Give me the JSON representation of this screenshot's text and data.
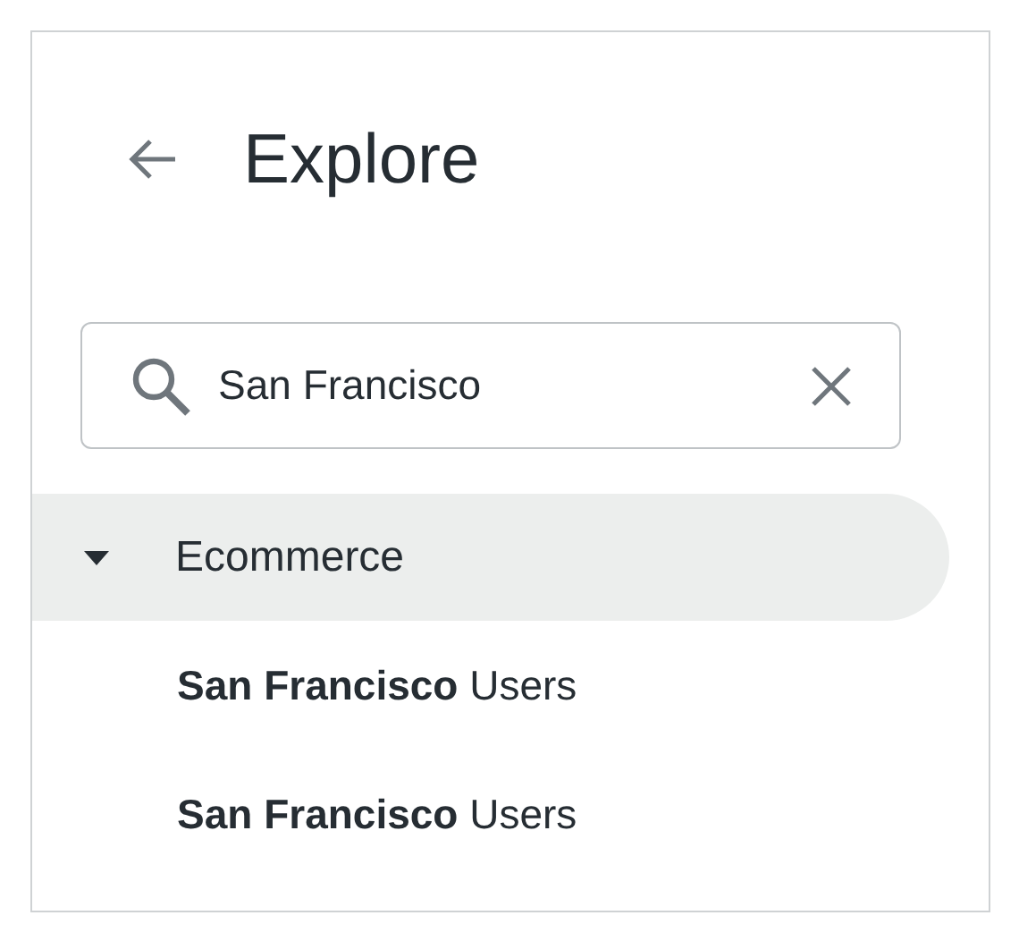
{
  "header": {
    "title": "Explore"
  },
  "search": {
    "value": "San Francisco"
  },
  "tree": [
    {
      "label": "Ecommerce",
      "expanded": true,
      "selected": true,
      "children": [
        {
          "label": "**San Francisco** Users"
        },
        {
          "label": "**San Francisco** Users"
        }
      ]
    }
  ]
}
